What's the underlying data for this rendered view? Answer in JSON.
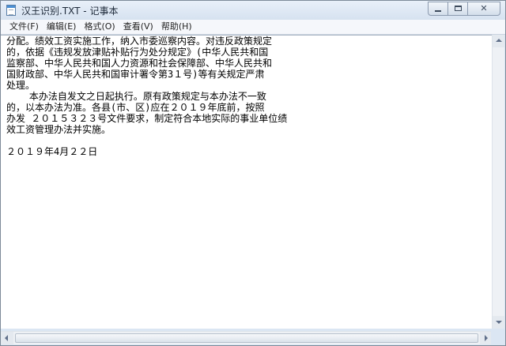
{
  "window": {
    "title": "汉王识别.TXT - 记事本",
    "icon": "notepad-icon",
    "controls": {
      "minimize_icon": "minimize-icon",
      "maximize_icon": "maximize-icon",
      "close_icon": "close-icon",
      "close_glyph": "✕"
    }
  },
  "menu": [
    {
      "label": "文件(F)"
    },
    {
      "label": "编辑(E)"
    },
    {
      "label": "格式(O)"
    },
    {
      "label": "查看(V)"
    },
    {
      "label": "帮助(H)"
    }
  ],
  "document": {
    "lines": [
      "分配。绩效工资实施工作，纳入市委巡察内容。对违反政策规定",
      "的，依据《违规发放津贴补贴行为处分规定》(中华人民共和国",
      "监察部、中华人民共和国人力资源和社会保障部、中华人民共和",
      "国财政部、中华人民共和国审计署令第3１号)等有关规定严肃",
      "处理。",
      "    本办法自发文之日起执行。原有政策规定与本办法不一致",
      "的，以本办法为准。各县(市、区)应在２０１９年底前，按照",
      "办发 ２０１５３２３号文件要求，制定符合本地实际的事业单位绩",
      "效工资管理办法并实施。",
      "",
      "２０１９年4月２２日"
    ]
  },
  "colors": {
    "frame": "#dbe6f3",
    "menubar": "#f5f7fb",
    "text": "#000000",
    "editor_bg": "#ffffff"
  }
}
